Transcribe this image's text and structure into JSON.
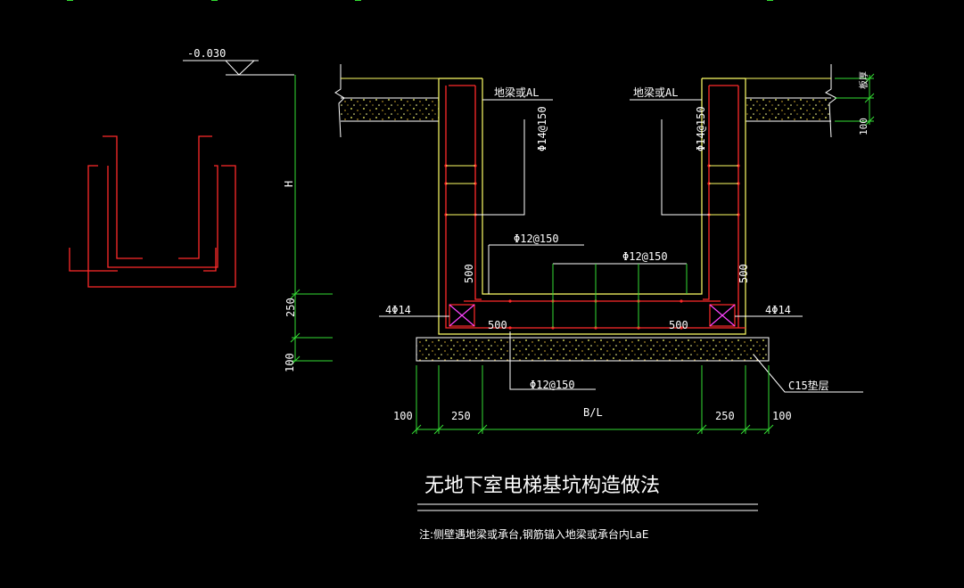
{
  "elevation": "-0.030",
  "labels": {
    "beam_left": "地梁或AL",
    "beam_right": "地梁或AL",
    "thickness": "板厚",
    "H": "H"
  },
  "rebar": {
    "wall_left": "Φ14@150",
    "wall_right": "Φ14@150",
    "floor_upper_left": "Φ12@150",
    "floor_upper_right": "Φ12@150",
    "floor_bottom": "Φ12@150",
    "corner_left": "4Φ14",
    "corner_right": "4Φ14"
  },
  "dims": {
    "left_100": "100",
    "left_250": "250",
    "bottom_100_left": "100",
    "bottom_250_left": "250",
    "bottom_BL": "B/L",
    "bottom_250_right": "250",
    "bottom_100_right": "100",
    "right_100": "100",
    "wall_500_left": "500",
    "wall_500_right": "500",
    "floor_500_left": "500",
    "floor_500_right": "500"
  },
  "cushion": "C15垫层",
  "title": "无地下室电梯基坑构造做法",
  "note": "注:侧壁遇地梁或承台,钢筋锚入地梁或承台内LaE",
  "colors": {
    "background": "#000000",
    "concrete_outline": "#ffff66",
    "rebar": "#ff2a2a",
    "dimension": "#33dd33",
    "text": "#ffffff",
    "leader": "#ffffff"
  }
}
